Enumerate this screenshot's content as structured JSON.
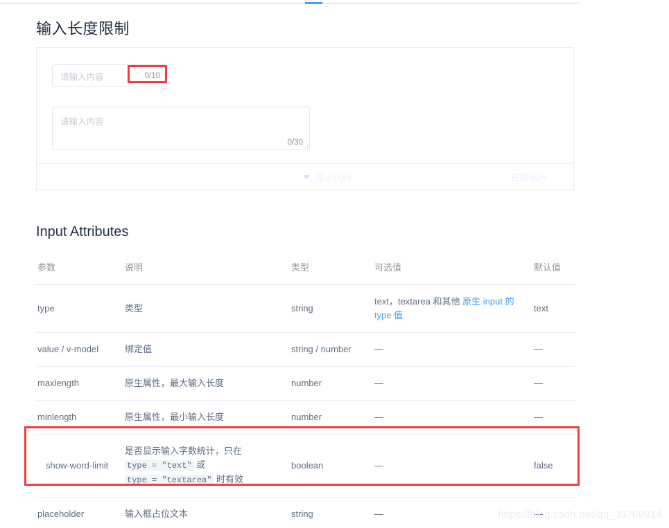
{
  "tabstrip": {
    "active_indicator": "tab-active-indicator"
  },
  "demo": {
    "section_title": "输入长度限制",
    "input": {
      "placeholder": "请输入内容",
      "word_count": "0/10"
    },
    "textarea": {
      "placeholder": "请输入内容",
      "word_count": "0/30"
    },
    "footer": {
      "show_code_label": "显示代码",
      "run_online_label": "在线运行"
    }
  },
  "attributes": {
    "title": "Input Attributes",
    "columns": [
      "参数",
      "说明",
      "类型",
      "可选值",
      "默认值"
    ],
    "rows": [
      {
        "param": "type",
        "desc": "类型",
        "type": "string",
        "options_prefix": "text，textarea 和其他 ",
        "options_link": "原生 input 的 type 值",
        "default": "text"
      },
      {
        "param": "value / v-model",
        "desc": "绑定值",
        "type": "string / number",
        "options": "—",
        "default": "—"
      },
      {
        "param": "maxlength",
        "desc": "原生属性，最大输入长度",
        "type": "number",
        "options": "—",
        "default": "—"
      },
      {
        "param": "minlength",
        "desc": "原生属性，最小输入长度",
        "type": "number",
        "options": "—",
        "default": "—"
      },
      {
        "param": "show-word-limit",
        "desc_part1": "是否显示输入字数统计，只在 ",
        "desc_code1": "type = \"text\"",
        "desc_part2": " 或 ",
        "desc_code2": "type = \"textarea\"",
        "desc_part3": " 时有效",
        "type": "boolean",
        "options": "—",
        "default": "false",
        "highlighted": true
      },
      {
        "param": "placeholder",
        "desc": "输入框占位文本",
        "type": "string",
        "options": "—",
        "default": "—"
      }
    ]
  },
  "annotations": {
    "highlight_color": "#f53b3b",
    "counter_box": "word-limit-counter-highlight",
    "row_box": "show-word-limit-row-highlight"
  },
  "watermark": {
    "text": "https://blog.csdn.net/qq_33769914"
  }
}
